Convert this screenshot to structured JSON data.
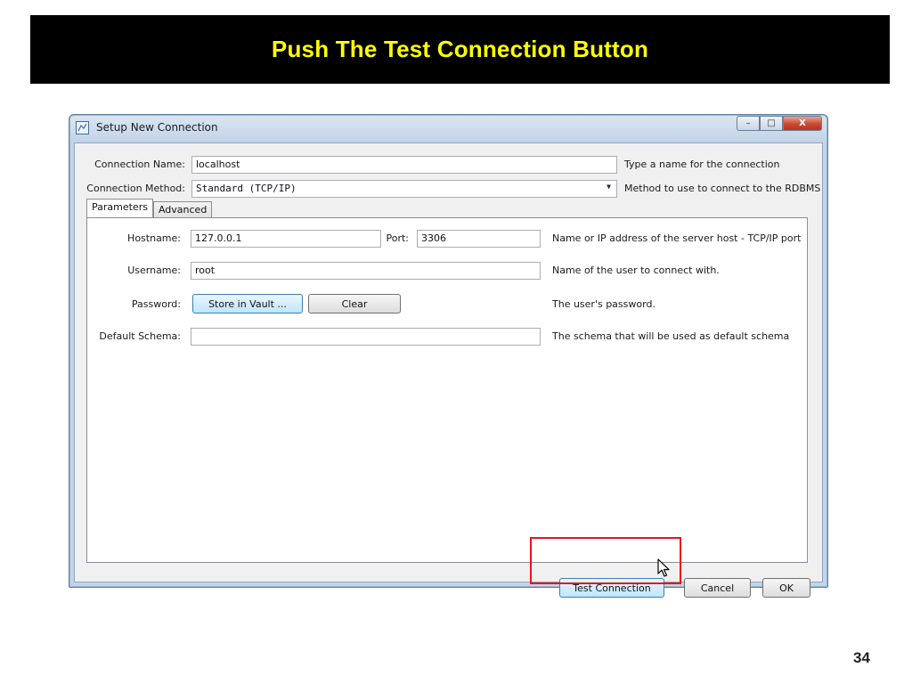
{
  "slide": {
    "title": "Push The Test Connection Button",
    "page_number": "34"
  },
  "window": {
    "title": "Setup New Connection",
    "minimize_glyph": "–",
    "maximize_glyph": "□",
    "close_glyph": "X",
    "icon": "connection-app-icon"
  },
  "form": {
    "connection_name_label": "Connection Name:",
    "connection_name_value": "localhost",
    "connection_name_hint": "Type a name for the connection",
    "connection_method_label": "Connection Method:",
    "connection_method_value": "Standard (TCP/IP)",
    "connection_method_hint": "Method to use to connect to the RDBMS"
  },
  "tabs": [
    {
      "label": "Parameters",
      "active": true
    },
    {
      "label": "Advanced",
      "active": false
    }
  ],
  "parameters": {
    "hostname_label": "Hostname:",
    "hostname_value": "127.0.0.1",
    "port_label": "Port:",
    "port_value": "3306",
    "hostname_hint": "Name or IP address of the server host - TCP/IP port",
    "username_label": "Username:",
    "username_value": "root",
    "username_hint": "Name of the user to connect with.",
    "password_label": "Password:",
    "store_in_vault_label": "Store in Vault ...",
    "clear_label": "Clear",
    "password_hint": "The user's password.",
    "default_schema_label": "Default Schema:",
    "default_schema_value": "",
    "default_schema_hint": "The schema that will be used as default schema"
  },
  "footer": {
    "test_connection_label": "Test Connection",
    "cancel_label": "Cancel",
    "ok_label": "OK"
  },
  "colors": {
    "title_bar_bg": "#000000",
    "title_text": "#ffff00",
    "highlight_border": "#e8121c"
  }
}
